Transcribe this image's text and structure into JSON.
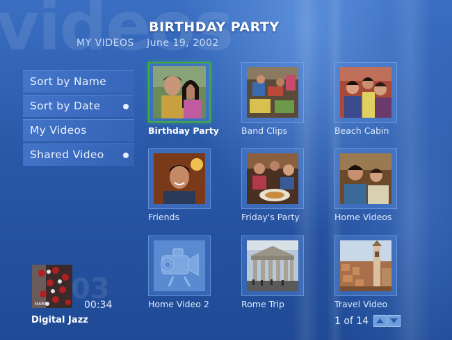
{
  "background": {
    "watermark_text": "videos"
  },
  "header": {
    "title": "BIRTHDAY PARTY",
    "breadcrumb": "MY VIDEOS",
    "date": "June 19, 2002"
  },
  "menu": {
    "items": [
      {
        "label": "Sort by Name",
        "dot": false
      },
      {
        "label": "Sort by Date",
        "dot": true
      },
      {
        "label": "My Videos",
        "dot": false
      },
      {
        "label": "Shared Video",
        "dot": true
      }
    ]
  },
  "grid": {
    "tiles": [
      {
        "label": "Birthday Party",
        "focused": true,
        "icon": "couple-photo-thumbnail"
      },
      {
        "label": "Band Clips",
        "focused": false,
        "icon": "band-photo-thumbnail"
      },
      {
        "label": "Beach Cabin",
        "focused": false,
        "icon": "group-photo-thumbnail"
      },
      {
        "label": "Friends",
        "focused": false,
        "icon": "portrait-photo-thumbnail"
      },
      {
        "label": "Friday's Party",
        "focused": false,
        "icon": "party-photo-thumbnail"
      },
      {
        "label": "Home Videos",
        "focused": false,
        "icon": "family-photo-thumbnail"
      },
      {
        "label": "Home Video 2",
        "focused": false,
        "icon": "video-camera-icon"
      },
      {
        "label": "Rome Trip",
        "focused": false,
        "icon": "pantheon-photo-thumbnail"
      },
      {
        "label": "Travel Video",
        "focused": false,
        "icon": "city-photo-thumbnail"
      }
    ]
  },
  "now_playing": {
    "big_number": "03",
    "time": "00:34",
    "title": "Digital Jazz",
    "art_label": "MARY"
  },
  "pager": {
    "text": "1 of 14",
    "up_icon": "arrow-up-icon",
    "down_icon": "arrow-down-icon"
  },
  "colors": {
    "focus_border": "#3fae3f",
    "background_top": "#3a6fc2",
    "background_bottom": "#1f4a95"
  }
}
